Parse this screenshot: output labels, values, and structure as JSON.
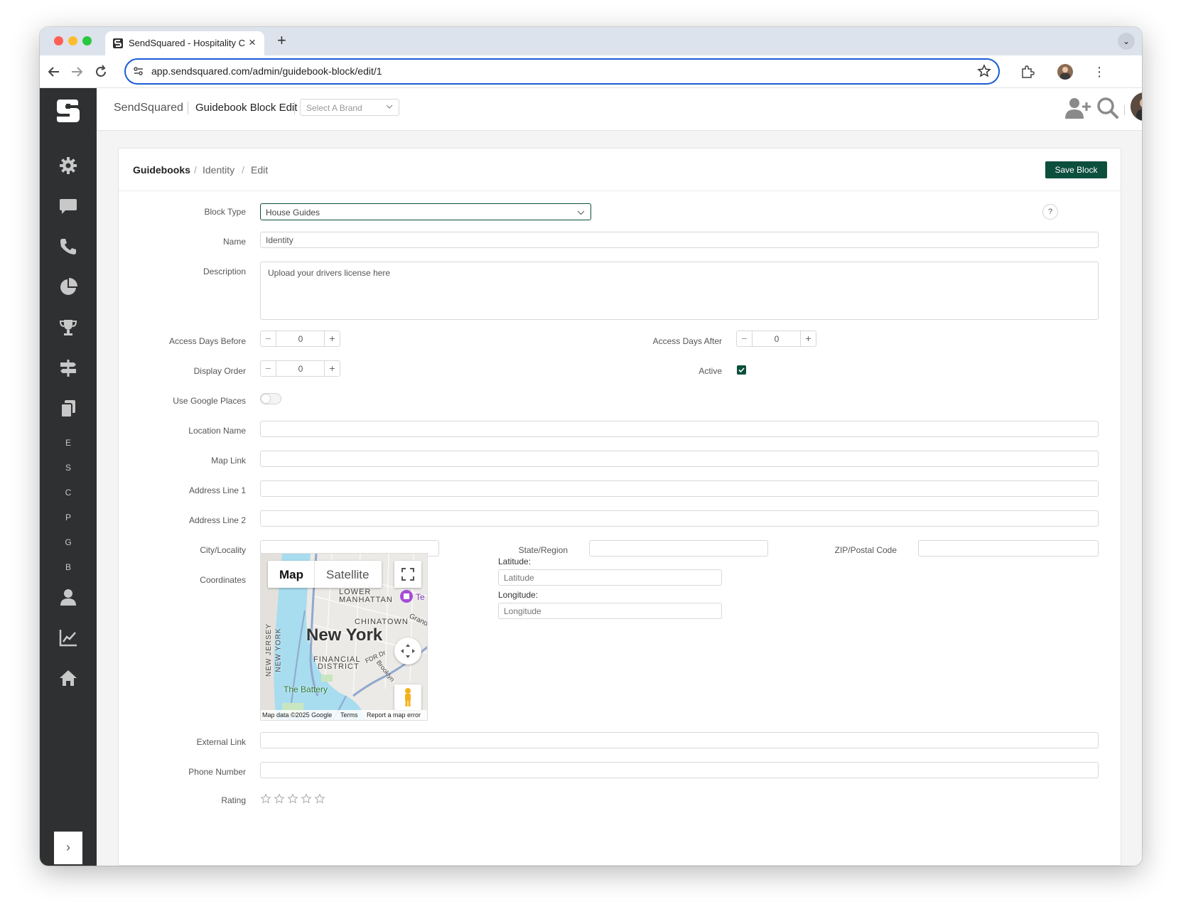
{
  "browser": {
    "tab_title": "SendSquared - Hospitality CRM",
    "tab_close": "×",
    "new_tab": "+",
    "tab_menu": "⌄",
    "url": "app.sendsquared.com/admin/guidebook-block/edit/1"
  },
  "sidebar": {
    "letters": [
      "E",
      "S",
      "C",
      "P",
      "G",
      "B"
    ],
    "toggle": "›"
  },
  "topbar": {
    "brand": "SendSquared",
    "page": "Guidebook Block Edit",
    "brand_select_placeholder": "Select A Brand"
  },
  "header": {
    "crumbs": [
      "Guidebooks",
      "Identity",
      "Edit"
    ],
    "sep": "/",
    "save_label": "Save Block"
  },
  "form": {
    "block_type_label": "Block Type",
    "block_type_value": "House Guides",
    "help": "?",
    "name_label": "Name",
    "name_value": "Identity",
    "description_label": "Description",
    "description_value": "Upload your drivers license here",
    "access_before_label": "Access Days Before",
    "access_before_value": "0",
    "access_after_label": "Access Days After",
    "access_after_value": "0",
    "display_order_label": "Display Order",
    "display_order_value": "0",
    "active_label": "Active",
    "active_checked": true,
    "google_places_label": "Use Google Places",
    "google_places_on": false,
    "location_name_label": "Location Name",
    "map_link_label": "Map Link",
    "address1_label": "Address Line 1",
    "address2_label": "Address Line 2",
    "city_label": "City/Locality",
    "state_label": "State/Region",
    "zip_label": "ZIP/Postal Code",
    "coordinates_label": "Coordinates",
    "latitude_label": "Latitude:",
    "latitude_placeholder": "Latitude",
    "longitude_label": "Longitude:",
    "longitude_placeholder": "Longitude",
    "external_link_label": "External Link",
    "phone_label": "Phone Number",
    "rating_label": "Rating",
    "rating_value": 0,
    "stepper_minus": "−",
    "stepper_plus": "+"
  },
  "map": {
    "tab_map": "Map",
    "tab_satellite": "Satellite",
    "city": "New York",
    "labels": [
      "LOWER",
      "MANHATTAN",
      "CHINATOWN",
      "FINANCIAL",
      "DISTRICT",
      "NEW JERSEY",
      "NEW YORK",
      "The Battery",
      "Brooklyn",
      "FDR Dr",
      "Grand",
      "Te"
    ],
    "footer_data": "Map data ©2025 Google",
    "footer_terms": "Terms",
    "footer_report": "Report a map error"
  },
  "colors": {
    "accent": "#0c4f3c",
    "sidebar": "#2f3031",
    "omnibox_border": "#1a5cd6"
  }
}
